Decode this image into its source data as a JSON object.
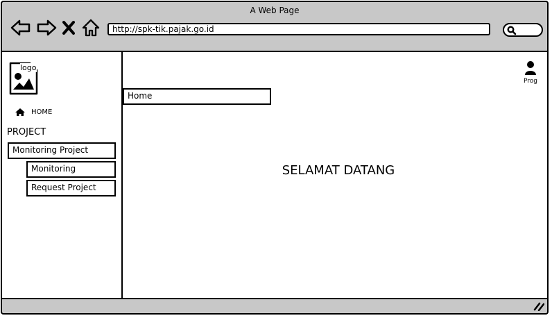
{
  "window": {
    "title": "A Web Page"
  },
  "toolbar": {
    "back_icon": "back-arrow-icon",
    "forward_icon": "forward-arrow-icon",
    "close_icon": "close-icon",
    "home_icon": "home-icon"
  },
  "address_bar": {
    "url": "http://spk-tik.pajak.go.id"
  },
  "search": {
    "icon": "search-icon"
  },
  "sidebar": {
    "logo_text": "logo",
    "home_label": "HOME",
    "section_title": "PROJECT",
    "items": [
      {
        "label": "Monitoring Project"
      },
      {
        "label": "Monitoring"
      },
      {
        "label": "Request Project"
      }
    ]
  },
  "main": {
    "tab_label": "Home",
    "welcome": "SELAMAT DATANG",
    "user_label": "Prog"
  }
}
